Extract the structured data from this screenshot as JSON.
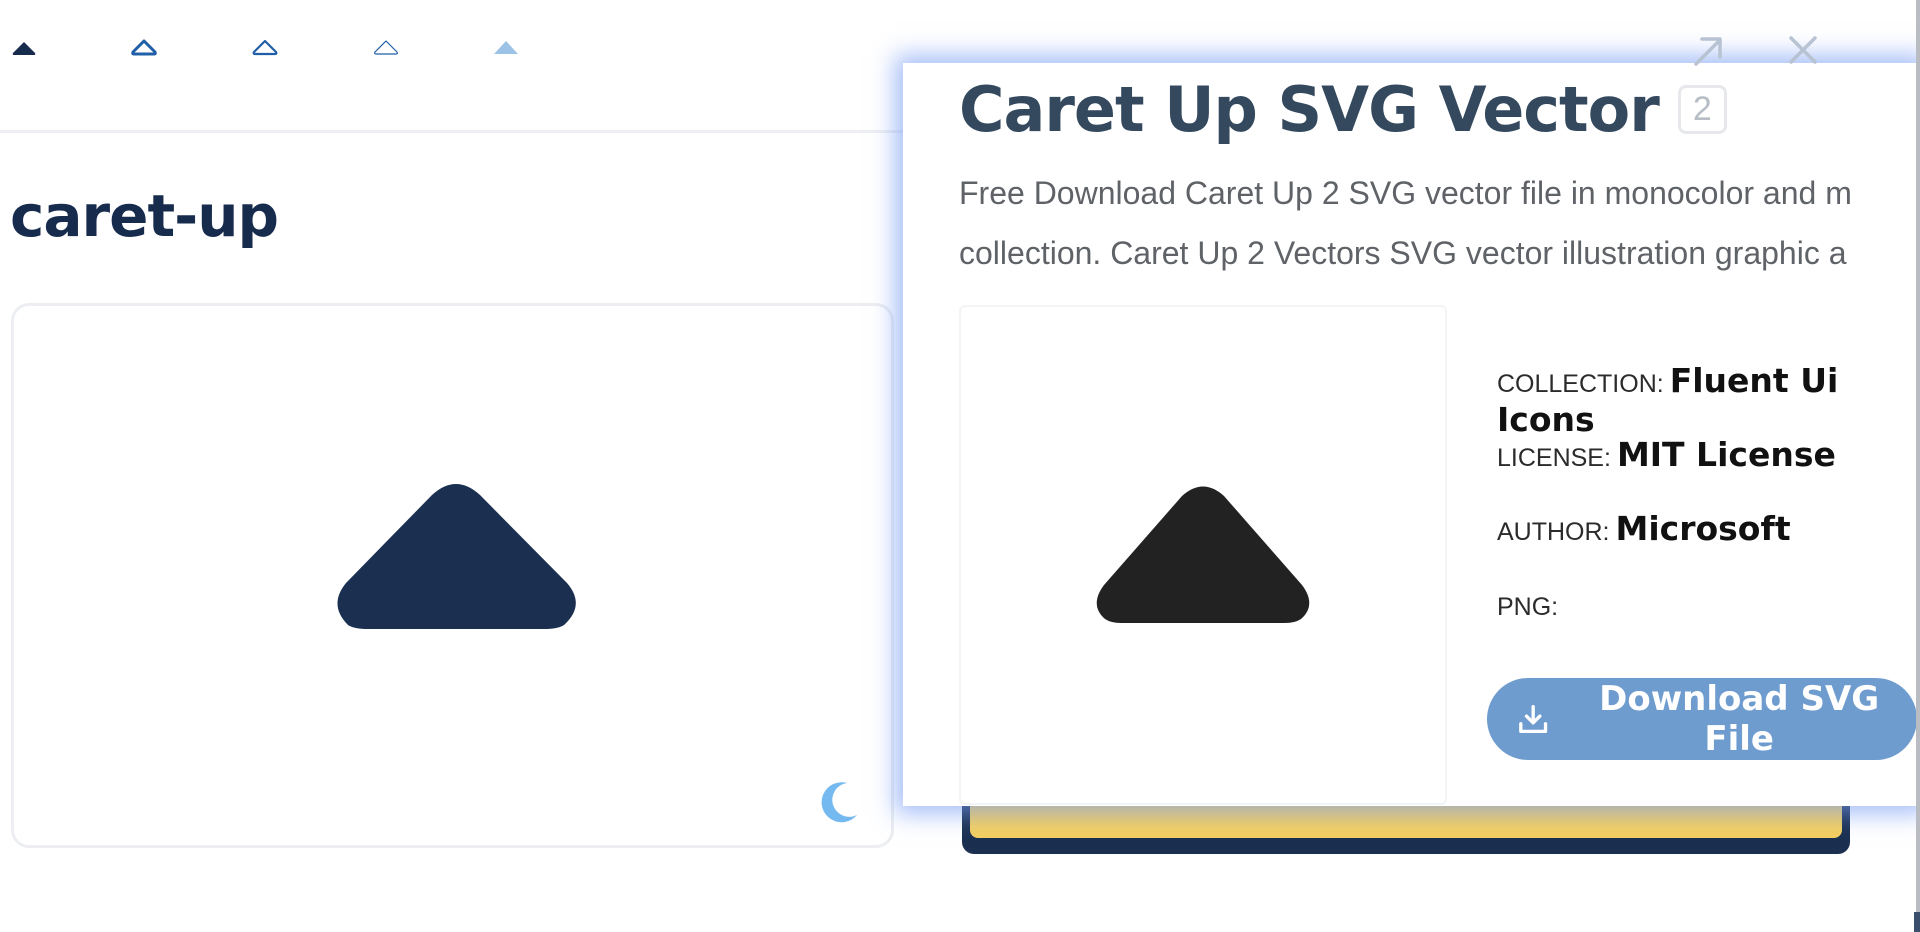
{
  "colors": {
    "navy": "#172b4d",
    "caret_dark": "#1b3050",
    "caret_black": "#222222",
    "accent_blue": "#1f5fa8",
    "light_blue": "#9cc2e5",
    "moon_blue": "#74b9f0",
    "download_button": "#6f9ccf",
    "modal_glow": "#789cf5",
    "yellow": "#f4cf60"
  },
  "variants": [
    {
      "icon": "caret-up-filled-icon"
    },
    {
      "icon": "caret-up-outline-bold-icon"
    },
    {
      "icon": "caret-up-outline-icon"
    },
    {
      "icon": "caret-up-outline-thin-icon"
    },
    {
      "icon": "caret-up-light-filled-icon"
    }
  ],
  "page": {
    "heading": "caret-up",
    "preview_icon": "caret-up-icon",
    "theme_toggle_icon": "moon-icon"
  },
  "top_actions": {
    "open_icon": "external-link-icon",
    "close_icon": "close-icon"
  },
  "modal": {
    "title": "Caret Up SVG Vector",
    "badge": "2",
    "description_line1": "Free Download Caret Up 2 SVG vector file in monocolor and m",
    "description_line2": "collection. Caret Up 2 Vectors SVG vector illustration graphic a",
    "preview_icon": "caret-up-icon",
    "meta": {
      "collection_label": "COLLECTION:",
      "collection_value": "Fluent Ui Icons",
      "license_label": "LICENSE:",
      "license_value": "MIT License",
      "author_label": "AUTHOR:",
      "author_value": "Microsoft",
      "png_label": "PNG:"
    },
    "download_label": "Download SVG File",
    "download_icon": "download-icon"
  }
}
